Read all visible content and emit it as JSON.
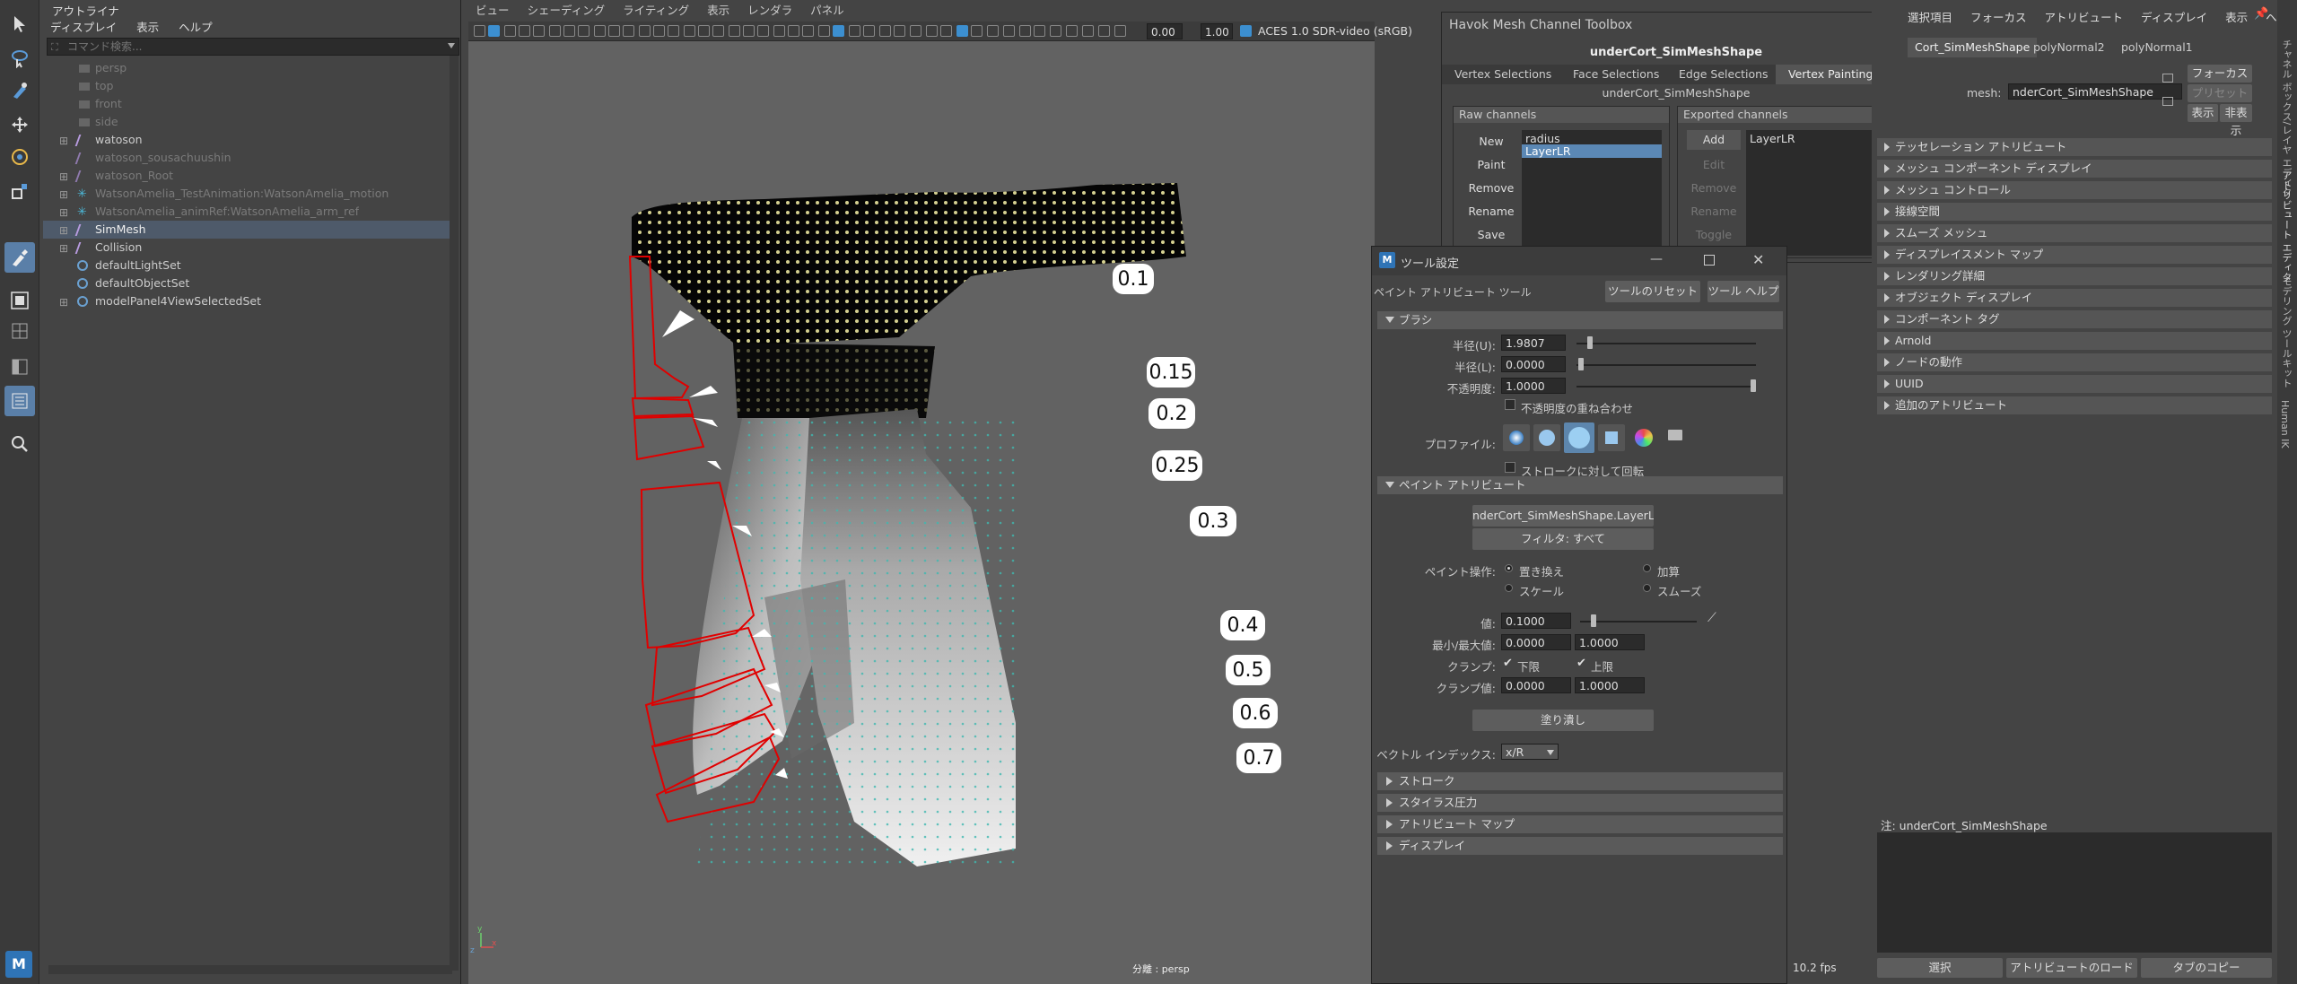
{
  "outliner": {
    "title": "アウトライナ",
    "menu": [
      "ディスプレイ",
      "表示",
      "ヘルプ"
    ],
    "search_placeholder": "コマンド検索...",
    "items": [
      {
        "label": "persp",
        "level": 1,
        "dim": true
      },
      {
        "label": "top",
        "level": 1,
        "dim": true
      },
      {
        "label": "front",
        "level": 1,
        "dim": true
      },
      {
        "label": "side",
        "level": 1,
        "dim": true
      },
      {
        "label": "watoson",
        "level": 0,
        "dim": false
      },
      {
        "label": "watoson_sousachuushin",
        "level": 0,
        "dim": true
      },
      {
        "label": "watoson_Root",
        "level": 0,
        "dim": true
      },
      {
        "label": "WatsonAmelia_TestAnimation:WatsonAmelia_motion",
        "level": 0,
        "dim": true
      },
      {
        "label": "WatsonAmelia_animRef:WatsonAmelia_arm_ref",
        "level": 0,
        "dim": true
      },
      {
        "label": "SimMesh",
        "level": 0,
        "dim": false,
        "selected": true
      },
      {
        "label": "Collision",
        "level": 0,
        "dim": false
      },
      {
        "label": "defaultLightSet",
        "level": 0,
        "dim": false
      },
      {
        "label": "defaultObjectSet",
        "level": 0,
        "dim": false
      },
      {
        "label": "modelPanel4ViewSelectedSet",
        "level": 0,
        "dim": false
      }
    ]
  },
  "viewport": {
    "menu": [
      "ビュー",
      "シェーディング",
      "ライティング",
      "表示",
      "レンダラ",
      "パネル"
    ],
    "exposure": "0.00",
    "gamma": "1.00",
    "colorspace": "ACES 1.0 SDR-video (sRGB)",
    "camera_label": "分離 : persp",
    "fps": "10.2 fps",
    "callouts": [
      "0.1",
      "0.15",
      "0.2",
      "0.25",
      "0.3",
      "0.4",
      "0.5",
      "0.6",
      "0.7"
    ]
  },
  "havok": {
    "title": "Havok Mesh Channel Toolbox",
    "mesh_name": "underCort_SimMeshShape",
    "tabs": [
      "Vertex Selections",
      "Face Selections",
      "Edge Selections",
      "Vertex Painting"
    ],
    "sub_title": "underCort_SimMeshShape",
    "raw_label": "Raw channels",
    "exported_label": "Exported channels",
    "raw_buttons": [
      "New",
      "Paint",
      "Remove",
      "Rename",
      "Save"
    ],
    "raw_list": [
      "radius",
      "LayerLR"
    ],
    "exp_buttons": [
      "Add",
      "Edit",
      "Remove",
      "Rename",
      "Toggle"
    ],
    "exp_list": [
      "LayerLR"
    ]
  },
  "tool_settings": {
    "title": "ツール設定",
    "tool_name": "ペイント アトリビュート ツール",
    "reset_button": "ツールのリセット",
    "help_button": "ツール ヘルプ",
    "brush_section": "ブラシ",
    "radius_u_label": "半径(U):",
    "radius_u": "1.9807",
    "radius_l_label": "半径(L):",
    "radius_l": "0.0000",
    "opacity_label": "不透明度:",
    "opacity": "1.0000",
    "opacity_accum": "不透明度の重ね合わせ",
    "profile_label": "プロファイル:",
    "rotate_stroke": "ストロークに対して回転",
    "paint_attr_section": "ペイント アトリビュート",
    "attr_button": "nderCort_SimMeshShape.LayerLR",
    "filter_button": "フィルタ: すべて",
    "paint_op_label": "ペイント操作:",
    "op_replace": "置き換え",
    "op_add": "加算",
    "op_scale": "スケール",
    "op_smooth": "スムーズ",
    "value_label": "値:",
    "value": "0.1000",
    "minmax_label": "最小/最大値:",
    "min": "0.0000",
    "max": "1.0000",
    "clamp_label": "クランプ:",
    "clamp_lower": "下限",
    "clamp_upper": "上限",
    "clamp_value_label": "クランプ値:",
    "clamp_min": "0.0000",
    "clamp_max": "1.0000",
    "flood_button": "塗り潰し",
    "vector_label": "ベクトル インデックス:",
    "vector_value": "x/R",
    "collapsed_sections": [
      "ストローク",
      "スタイラス圧力",
      "アトリビュート マップ",
      "ディスプレイ"
    ]
  },
  "attribute_editor": {
    "menu": [
      "選択項目",
      "フォーカス",
      "アトリビュート",
      "ディスプレイ",
      "表示",
      "ヘルプ"
    ],
    "tabs": [
      "Cort_SimMeshShape",
      "polyNormal2",
      "polyNormal1"
    ],
    "mesh_label": "mesh:",
    "mesh_value": "nderCort_SimMeshShape",
    "focus_button": "フォーカス",
    "preset_button": "プリセット",
    "show_button": "表示",
    "hide_button": "非表示",
    "sections": [
      "テッセレーション アトリビュート",
      "メッシュ コンポーネント ディスプレイ",
      "メッシュ コントロール",
      "接線空間",
      "スムーズ メッシュ",
      "ディスプレイスメント マップ",
      "レンダリング詳細",
      "オブジェクト ディスプレイ",
      "コンポーネント タグ",
      "Arnold",
      "ノードの動作",
      "UUID",
      "追加のアトリビュート"
    ],
    "notes_label": "注: underCort_SimMeshShape",
    "bottom_buttons": [
      "選択",
      "アトリビュートのロード",
      "タブのコピー"
    ],
    "side_tabs": [
      "チャネル ボックス/レイヤ エディタ",
      "アトリビュート エディタ",
      "モデリング ツールキット",
      "Human IK"
    ]
  }
}
